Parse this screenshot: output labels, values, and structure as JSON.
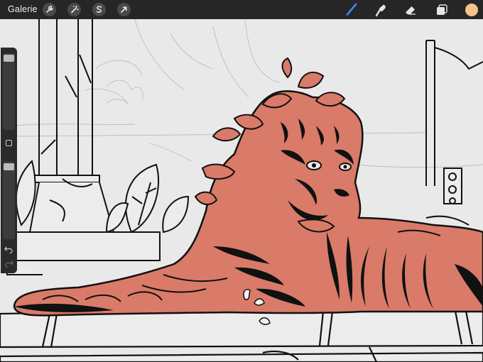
{
  "topbar": {
    "gallery_label": "Galerie",
    "action_icons": [
      "wrench-icon",
      "magic-wand-icon",
      "selection-icon",
      "transform-icon"
    ],
    "tool_icons": [
      "brush-icon",
      "smudge-icon",
      "eraser-icon",
      "layers-icon"
    ],
    "active_tool": "brush-icon",
    "active_color": "#f2c48a"
  },
  "sidebar": {
    "brush_size_level": 0.05,
    "opacity_level": 0.03,
    "icons": [
      "modify-square-icon",
      "undo-icon",
      "redo-icon"
    ]
  },
  "canvas": {
    "fill_color": "#d97b68",
    "line_color": "#111111",
    "background_color": "#e9e9e9"
  }
}
